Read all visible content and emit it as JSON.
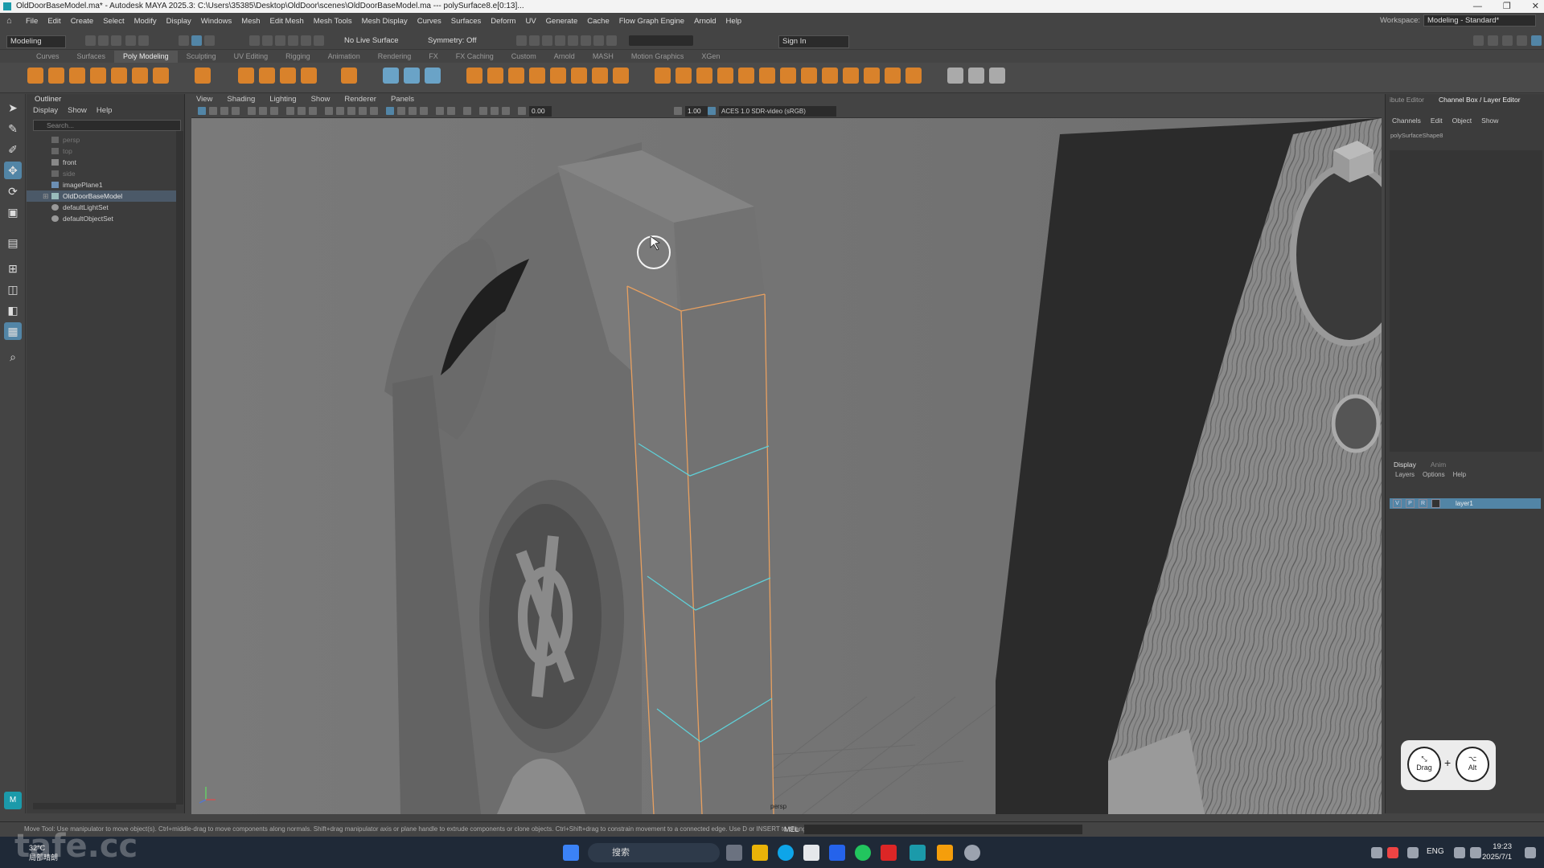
{
  "titlebar": {
    "title": "OldDoorBaseModel.ma* - Autodesk MAYA 2025.3: C:\\Users\\35385\\Desktop\\OldDoor\\scenes\\OldDoorBaseModel.ma  ---  polySurface8.e[0:13]...",
    "buttons": [
      "—",
      "❐",
      "✕"
    ]
  },
  "menubar": {
    "items": [
      "File",
      "Edit",
      "Create",
      "Select",
      "Modify",
      "Display",
      "Windows",
      "Mesh",
      "Edit Mesh",
      "Mesh Tools",
      "Mesh Display",
      "Curves",
      "Surfaces",
      "Deform",
      "UV",
      "Generate",
      "Cache",
      "Flow Graph Engine",
      "Arnold",
      "Help"
    ],
    "workspace_label": "Workspace:",
    "workspace_value": "Modeling - Standard*"
  },
  "statusline": {
    "mode": "Modeling",
    "live_surface": "No Live Surface",
    "symmetry": "Symmetry: Off",
    "signin": "Sign In"
  },
  "shelf": {
    "tabs": [
      "Curves",
      "Surfaces",
      "Poly Modeling",
      "Sculpting",
      "UV Editing",
      "Rigging",
      "Animation",
      "Rendering",
      "FX",
      "FX Caching",
      "Custom",
      "Arnold",
      "MASH",
      "Motion Graphics",
      "XGen"
    ],
    "active_tab": "Poly Modeling"
  },
  "outliner": {
    "title": "Outliner",
    "menu": [
      "Display",
      "Show",
      "Help"
    ],
    "search_placeholder": "Search...",
    "items": [
      {
        "label": "persp",
        "dim": true
      },
      {
        "label": "top",
        "dim": true
      },
      {
        "label": "front",
        "dim": false
      },
      {
        "label": "side",
        "dim": true
      },
      {
        "label": "imagePlane1",
        "dim": false
      },
      {
        "label": "OldDoorBaseModel",
        "dim": false,
        "selected": true,
        "expandable": true
      },
      {
        "label": "defaultLightSet",
        "dim": false
      },
      {
        "label": "defaultObjectSet",
        "dim": false
      }
    ]
  },
  "viewport": {
    "menu": [
      "View",
      "Shading",
      "Lighting",
      "Show",
      "Renderer",
      "Panels"
    ],
    "exposure": "0.00",
    "gamma": "1.00",
    "colorspace": "ACES 1.0 SDR-video (sRGB)",
    "camera_label": "persp"
  },
  "rightpanel": {
    "tab1": "ibute Editor",
    "tab2": "Channel Box / Layer Editor",
    "channel_menu": [
      "Channels",
      "Edit",
      "Object",
      "Show"
    ],
    "shape_name": "polySurfaceShape8",
    "layer_tabs": [
      "Display",
      "Anim"
    ],
    "layer_menu": [
      "Layers",
      "Options",
      "Help"
    ],
    "layer_flags": [
      "V",
      "P",
      "R"
    ],
    "layer_name": "layer1"
  },
  "drag_widget": {
    "key1": "Drag",
    "key2": "Alt",
    "plus": "+"
  },
  "helpline": {
    "text": "Move Tool: Use manipulator to move object(s). Ctrl+middle-drag to move components along normals. Shift+drag manipulator axis or plane handle to extrude components or clone objects. Ctrl+Shift+drag to constrain movement to a connected edge. Use D or INSERT to change th",
    "mel_label": "MEL"
  },
  "taskbar": {
    "search_label": "搜索",
    "weather_temp": "32°C",
    "weather_desc": "局部晴朗",
    "lang": "ENG",
    "time": "19:23",
    "date": "2025/7/1"
  },
  "watermark": "tafe.cc",
  "colors": {
    "selection_blue": "#5285a6",
    "edge_orange": "#e8a060",
    "edge_cyan": "#5fd0d8"
  }
}
